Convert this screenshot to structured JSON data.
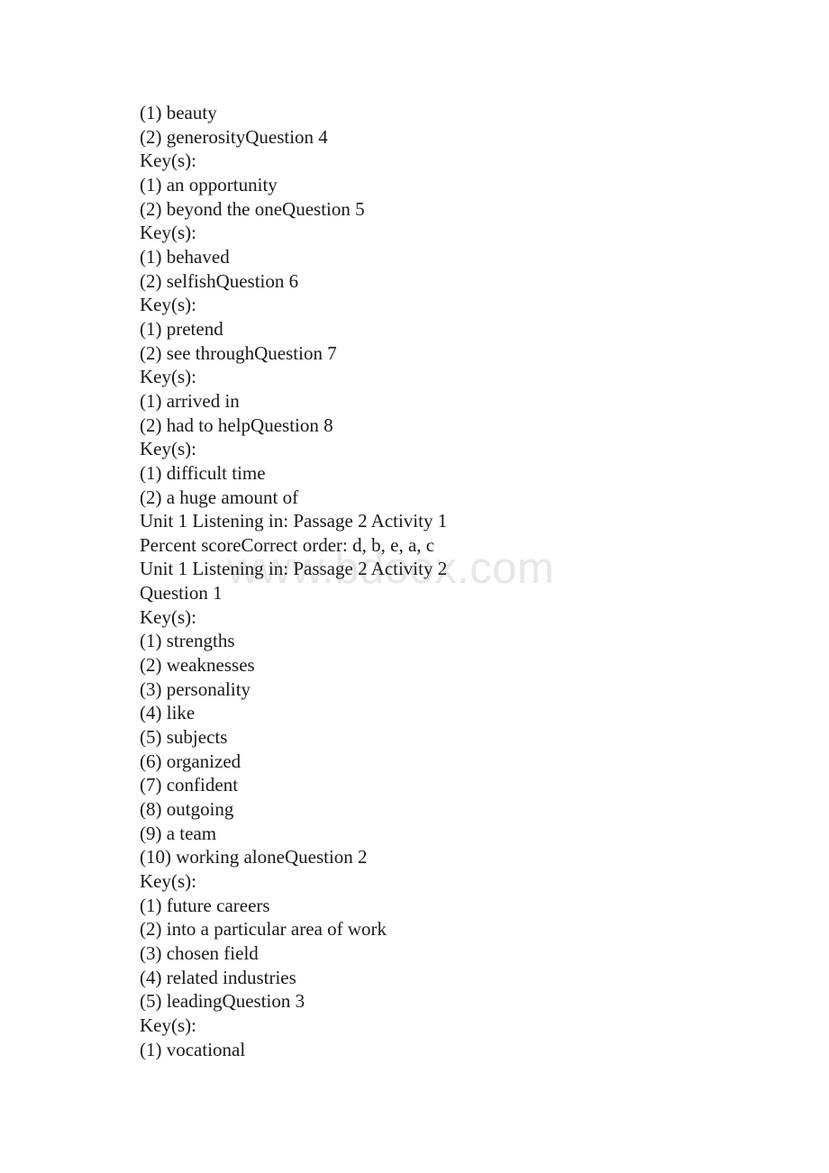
{
  "document": {
    "background_color": "#ffffff",
    "text_color": "#1a1a1a",
    "watermark": {
      "text": "www.bdoox.com",
      "color": "#e7e7e7"
    },
    "lines": [
      "(1) beauty",
      "(2) generosityQuestion 4",
      "Key(s):",
      "(1) an opportunity",
      "(2) beyond the oneQuestion 5",
      "Key(s):",
      "(1) behaved",
      "(2) selfishQuestion 6",
      "Key(s):",
      "(1) pretend",
      "(2) see throughQuestion 7",
      "Key(s):",
      "(1) arrived in",
      "(2) had to helpQuestion 8",
      "Key(s):",
      "(1) difficult time",
      "(2) a huge amount of",
      "Unit 1 Listening in: Passage 2 Activity 1",
      "Percent scoreCorrect order: d, b, e, a, c",
      "Unit 1 Listening in: Passage 2 Activity 2",
      "Question 1",
      "Key(s):",
      "(1) strengths",
      "(2) weaknesses",
      "(3) personality",
      "(4) like",
      "(5) subjects",
      "(6) organized",
      "(7) confident",
      "(8) outgoing",
      "(9) a team",
      "(10) working aloneQuestion 2",
      "Key(s):",
      "(1) future careers",
      "(2) into a particular area of work",
      "(3) chosen field",
      "(4) related industries",
      "(5) leadingQuestion 3",
      "Key(s):",
      "(1) vocational"
    ]
  }
}
